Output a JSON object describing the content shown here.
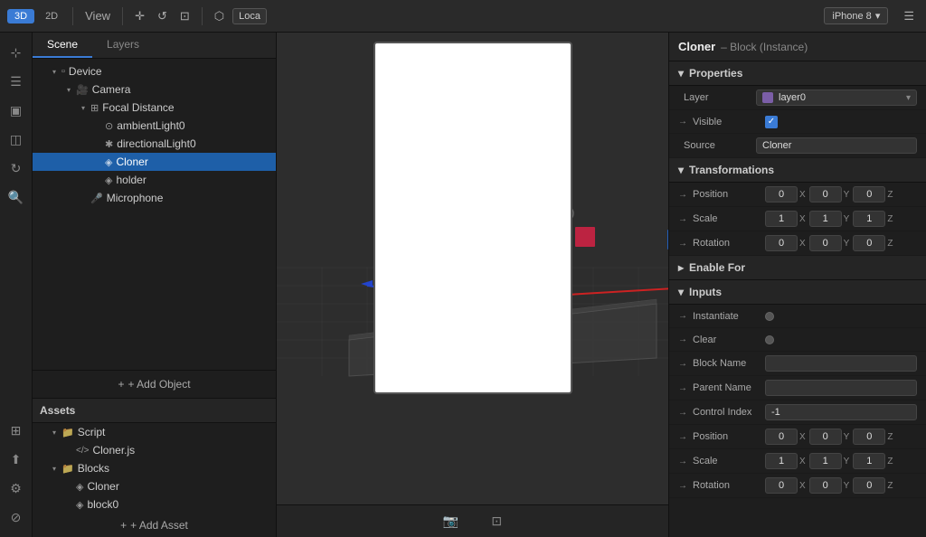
{
  "topbar": {
    "view3d": "3D",
    "view2d": "2D",
    "view_label": "View",
    "location_label": "Loca",
    "device_label": "iPhone 8",
    "menu_icon": "☰"
  },
  "scene_panel": {
    "tabs": [
      "Scene",
      "Layers"
    ],
    "tree": [
      {
        "id": "device",
        "label": "Device",
        "indent": 1,
        "icon": "▫",
        "type": "object",
        "expanded": true
      },
      {
        "id": "camera",
        "label": "Camera",
        "indent": 2,
        "icon": "📷",
        "type": "camera",
        "expanded": true
      },
      {
        "id": "focal",
        "label": "Focal Distance",
        "indent": 3,
        "icon": "⊞",
        "type": "focal",
        "expanded": true
      },
      {
        "id": "ambient",
        "label": "ambientLight0",
        "indent": 4,
        "icon": "⊙",
        "type": "light"
      },
      {
        "id": "directional",
        "label": "directionalLight0",
        "indent": 4,
        "icon": "✱",
        "type": "light"
      },
      {
        "id": "cloner",
        "label": "Cloner",
        "indent": 4,
        "icon": "◈",
        "type": "object",
        "selected": true
      },
      {
        "id": "holder",
        "label": "holder",
        "indent": 4,
        "icon": "◈",
        "type": "object"
      },
      {
        "id": "microphone",
        "label": "Microphone",
        "indent": 3,
        "icon": "🎤",
        "type": "mic"
      }
    ],
    "add_object_label": "+ Add Object"
  },
  "assets_panel": {
    "header": "Assets",
    "items": [
      {
        "id": "script",
        "label": "Script",
        "indent": 1,
        "icon": "📁",
        "expanded": true
      },
      {
        "id": "cloner_js",
        "label": "Cloner.js",
        "indent": 2,
        "icon": "</>"
      },
      {
        "id": "blocks",
        "label": "Blocks",
        "indent": 1,
        "icon": "📁",
        "expanded": true
      },
      {
        "id": "cloner_block",
        "label": "Cloner",
        "indent": 2,
        "icon": "◈"
      },
      {
        "id": "block0",
        "label": "block0",
        "indent": 2,
        "icon": "◈"
      }
    ],
    "add_asset_label": "+ Add Asset"
  },
  "properties": {
    "title": "Cloner",
    "subtitle": "– Block (Instance)",
    "sections": {
      "properties": {
        "label": "Properties",
        "layer": {
          "label": "Layer",
          "value": "layer0"
        },
        "visible": {
          "label": "Visible",
          "checked": true
        },
        "source": {
          "label": "Source",
          "value": "Cloner"
        }
      },
      "transformations": {
        "label": "Transformations",
        "position": {
          "label": "Position",
          "x": "0",
          "y": "0",
          "z": "0"
        },
        "scale": {
          "label": "Scale",
          "x": "1",
          "y": "1",
          "z": "1"
        },
        "rotation": {
          "label": "Rotation",
          "x": "0",
          "y": "0",
          "z": "0"
        }
      },
      "enable_for": {
        "label": "Enable For"
      },
      "inputs": {
        "label": "Inputs",
        "instantiate": {
          "label": "Instantiate"
        },
        "clear": {
          "label": "Clear"
        },
        "block_name": {
          "label": "Block Name",
          "value": ""
        },
        "parent_name": {
          "label": "Parent Name",
          "value": ""
        },
        "control_index": {
          "label": "Control Index",
          "value": "-1"
        },
        "position": {
          "label": "Position",
          "x": "0",
          "y": "0",
          "z": "0"
        },
        "scale": {
          "label": "Scale",
          "x": "1",
          "y": "1",
          "z": "1"
        },
        "rotation": {
          "label": "Rotation",
          "x": "0",
          "y": "0",
          "z": "0"
        }
      }
    }
  },
  "icons": {
    "arrow_right": "→",
    "arrow_down": "▾",
    "arrow_right_small": "▸",
    "check": "✓",
    "plus": "+",
    "three_d": "3D",
    "two_d": "2D"
  }
}
